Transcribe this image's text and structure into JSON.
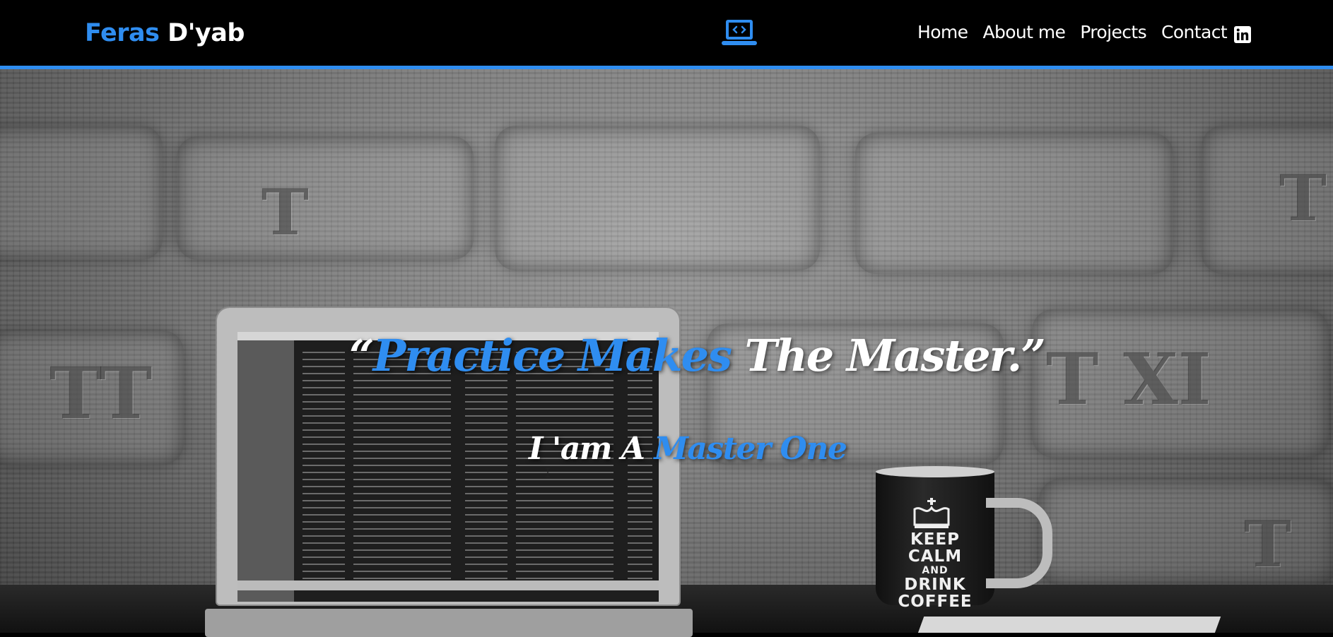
{
  "navbar": {
    "brand_first": "Feras",
    "brand_last": "D'yab",
    "logo_icon": "laptop-code-icon",
    "links": [
      "Home",
      "About me",
      "Projects",
      "Contact"
    ],
    "social_icon": "linkedin-icon"
  },
  "hero": {
    "quote_open": "“",
    "quote_blue": "Practice Makes",
    "quote_white": " The Master.”",
    "sub_white": "I 'am A ",
    "sub_blue": "Master One"
  },
  "mug": {
    "line1": "KEEP",
    "line2": "CALM",
    "line3": "AND",
    "line4": "DRINK",
    "line5": "COFFEE"
  },
  "colors": {
    "accent": "#2f8df0",
    "background": "#000000",
    "text": "#ffffff"
  }
}
